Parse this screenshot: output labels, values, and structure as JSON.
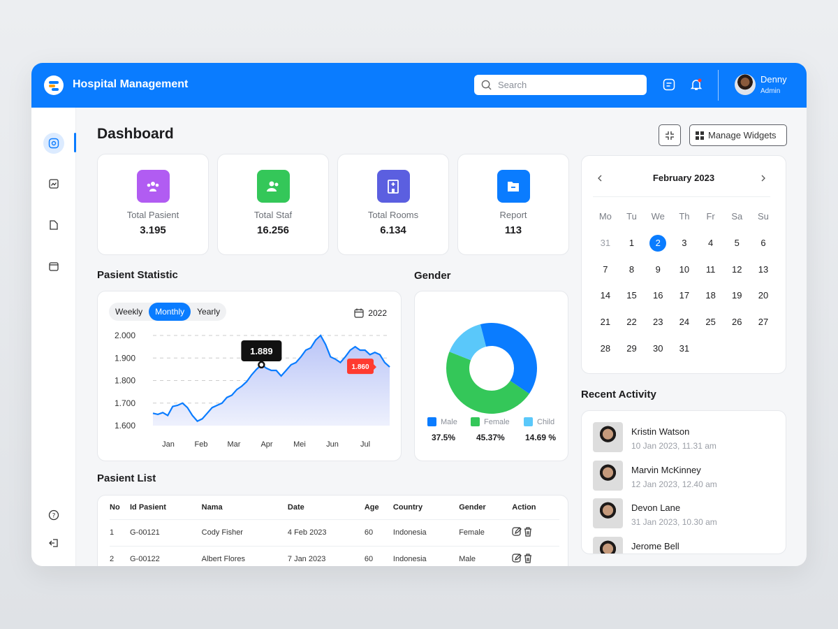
{
  "header": {
    "title": "Hospital Management",
    "search_placeholder": "Search",
    "user": {
      "name": "Denny",
      "role": "Admin"
    }
  },
  "sidebar": {
    "items": [
      {
        "icon": "dashboard-icon",
        "active": true
      },
      {
        "icon": "chart-icon"
      },
      {
        "icon": "document-icon"
      },
      {
        "icon": "folder-icon"
      }
    ],
    "bottom": [
      {
        "icon": "help-icon"
      },
      {
        "icon": "logout-icon"
      }
    ]
  },
  "page": {
    "title": "Dashboard",
    "manage_widgets": "Manage Widgets"
  },
  "stats": [
    {
      "label": "Total Pasient",
      "value": "3.195",
      "color": "#b15cf2",
      "icon": "patients-icon"
    },
    {
      "label": "Total Staf",
      "value": "16.256",
      "color": "#34c759",
      "icon": "staff-icon"
    },
    {
      "label": "Total Rooms",
      "value": "6.134",
      "color": "#5b5fe0",
      "icon": "hospital-room-icon"
    },
    {
      "label": "Report",
      "value": "113",
      "color": "#0a7cff",
      "icon": "report-folder-icon"
    }
  ],
  "statistic": {
    "title": "Pasient Statistic",
    "tabs": [
      "Weekly",
      "Monthly",
      "Yearly"
    ],
    "active_tab": "Monthly",
    "year": "2022"
  },
  "chart_data": {
    "type": "area",
    "x_ticks": [
      "Jan",
      "Feb",
      "Mar",
      "Apr",
      "Mei",
      "Jun",
      "Jul"
    ],
    "y_ticks": [
      "2.000",
      "1.900",
      "1.800",
      "1.700",
      "1.600"
    ],
    "ylim": [
      1600,
      2000
    ],
    "grid": true,
    "values": [
      1655,
      1650,
      1658,
      1645,
      1685,
      1690,
      1700,
      1680,
      1645,
      1620,
      1630,
      1655,
      1680,
      1690,
      1700,
      1725,
      1735,
      1760,
      1775,
      1795,
      1825,
      1850,
      1870,
      1855,
      1845,
      1845,
      1820,
      1845,
      1870,
      1880,
      1905,
      1935,
      1945,
      1980,
      2000,
      1960,
      1905,
      1895,
      1880,
      1905,
      1935,
      1950,
      1935,
      1935,
      1915,
      1925,
      1915,
      1880,
      1860
    ],
    "highlight": {
      "index": 22,
      "label": "1.889"
    },
    "last_label": "1.860"
  },
  "gender": {
    "title": "Gender",
    "chart_data": {
      "type": "pie",
      "slices": [
        {
          "name": "Male",
          "value": 37.5,
          "label": "37.5%",
          "color": "#0a7cff"
        },
        {
          "name": "Female",
          "value": 45.37,
          "label": "45.37%",
          "color": "#34c759"
        },
        {
          "name": "Child",
          "value": 14.69,
          "label": "14.69 %",
          "color": "#5ac8fa"
        }
      ]
    }
  },
  "calendar": {
    "month": "February 2023",
    "weekdays": [
      "Mo",
      "Tu",
      "We",
      "Th",
      "Fr",
      "Sa",
      "Su"
    ],
    "weeks": [
      [
        "31",
        "1",
        "2",
        "3",
        "4",
        "5",
        "6"
      ],
      [
        "7",
        "8",
        "9",
        "10",
        "11",
        "12",
        "13"
      ],
      [
        "14",
        "15",
        "16",
        "17",
        "18",
        "19",
        "20"
      ],
      [
        "21",
        "22",
        "23",
        "24",
        "25",
        "26",
        "27"
      ],
      [
        "28",
        "29",
        "30",
        "31",
        "",
        "",
        ""
      ]
    ],
    "selected": "2"
  },
  "activity": {
    "title": "Recent Activity",
    "items": [
      {
        "name": "Kristin Watson",
        "date": "10 Jan 2023, 11.31 am"
      },
      {
        "name": "Marvin McKinney",
        "date": "12 Jan 2023, 12.40 am"
      },
      {
        "name": "Devon Lane",
        "date": "31 Jan 2023, 10.30 am"
      },
      {
        "name": "Jerome Bell",
        "date": ""
      }
    ]
  },
  "patients": {
    "title": "Pasient List",
    "columns": [
      "No",
      "Id Pasient",
      "Nama",
      "Date",
      "Age",
      "Country",
      "Gender",
      "Action"
    ],
    "rows": [
      [
        "1",
        "G-00121",
        "Cody Fisher",
        "4 Feb 2023",
        "60",
        "Indonesia",
        "Female"
      ],
      [
        "2",
        "G-00122",
        "Albert Flores",
        "7 Jan 2023",
        "60",
        "Indonesia",
        "Male"
      ]
    ]
  }
}
